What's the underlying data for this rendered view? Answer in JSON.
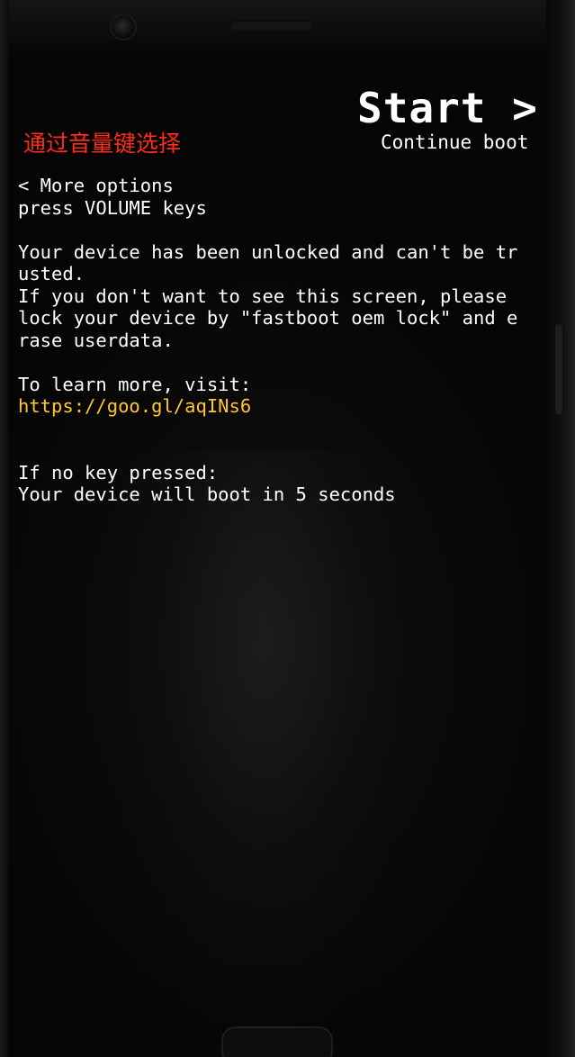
{
  "header": {
    "start_label": "Start >",
    "continue_label": "Continue boot",
    "volume_hint_cn": "通过音量键选择"
  },
  "menu": {
    "more_options": "< More options",
    "press_volume": "press VOLUME keys"
  },
  "warning": {
    "line1": "Your device has been unlocked and can't be tr",
    "line2": "usted.",
    "line3": "If you don't want to see this screen, please",
    "line4": "lock your device by \"fastboot oem lock\" and e",
    "line5": "rase userdata."
  },
  "learn_more": {
    "label": "To learn more, visit:",
    "url": "https://goo.gl/aqINs6"
  },
  "countdown": {
    "label": "If no key pressed:",
    "message": "Your device will boot in 5 seconds"
  },
  "colors": {
    "text": "#ffffff",
    "hint_red": "#ff2a1a",
    "link_yellow": "#ffc828",
    "background": "#050505"
  }
}
